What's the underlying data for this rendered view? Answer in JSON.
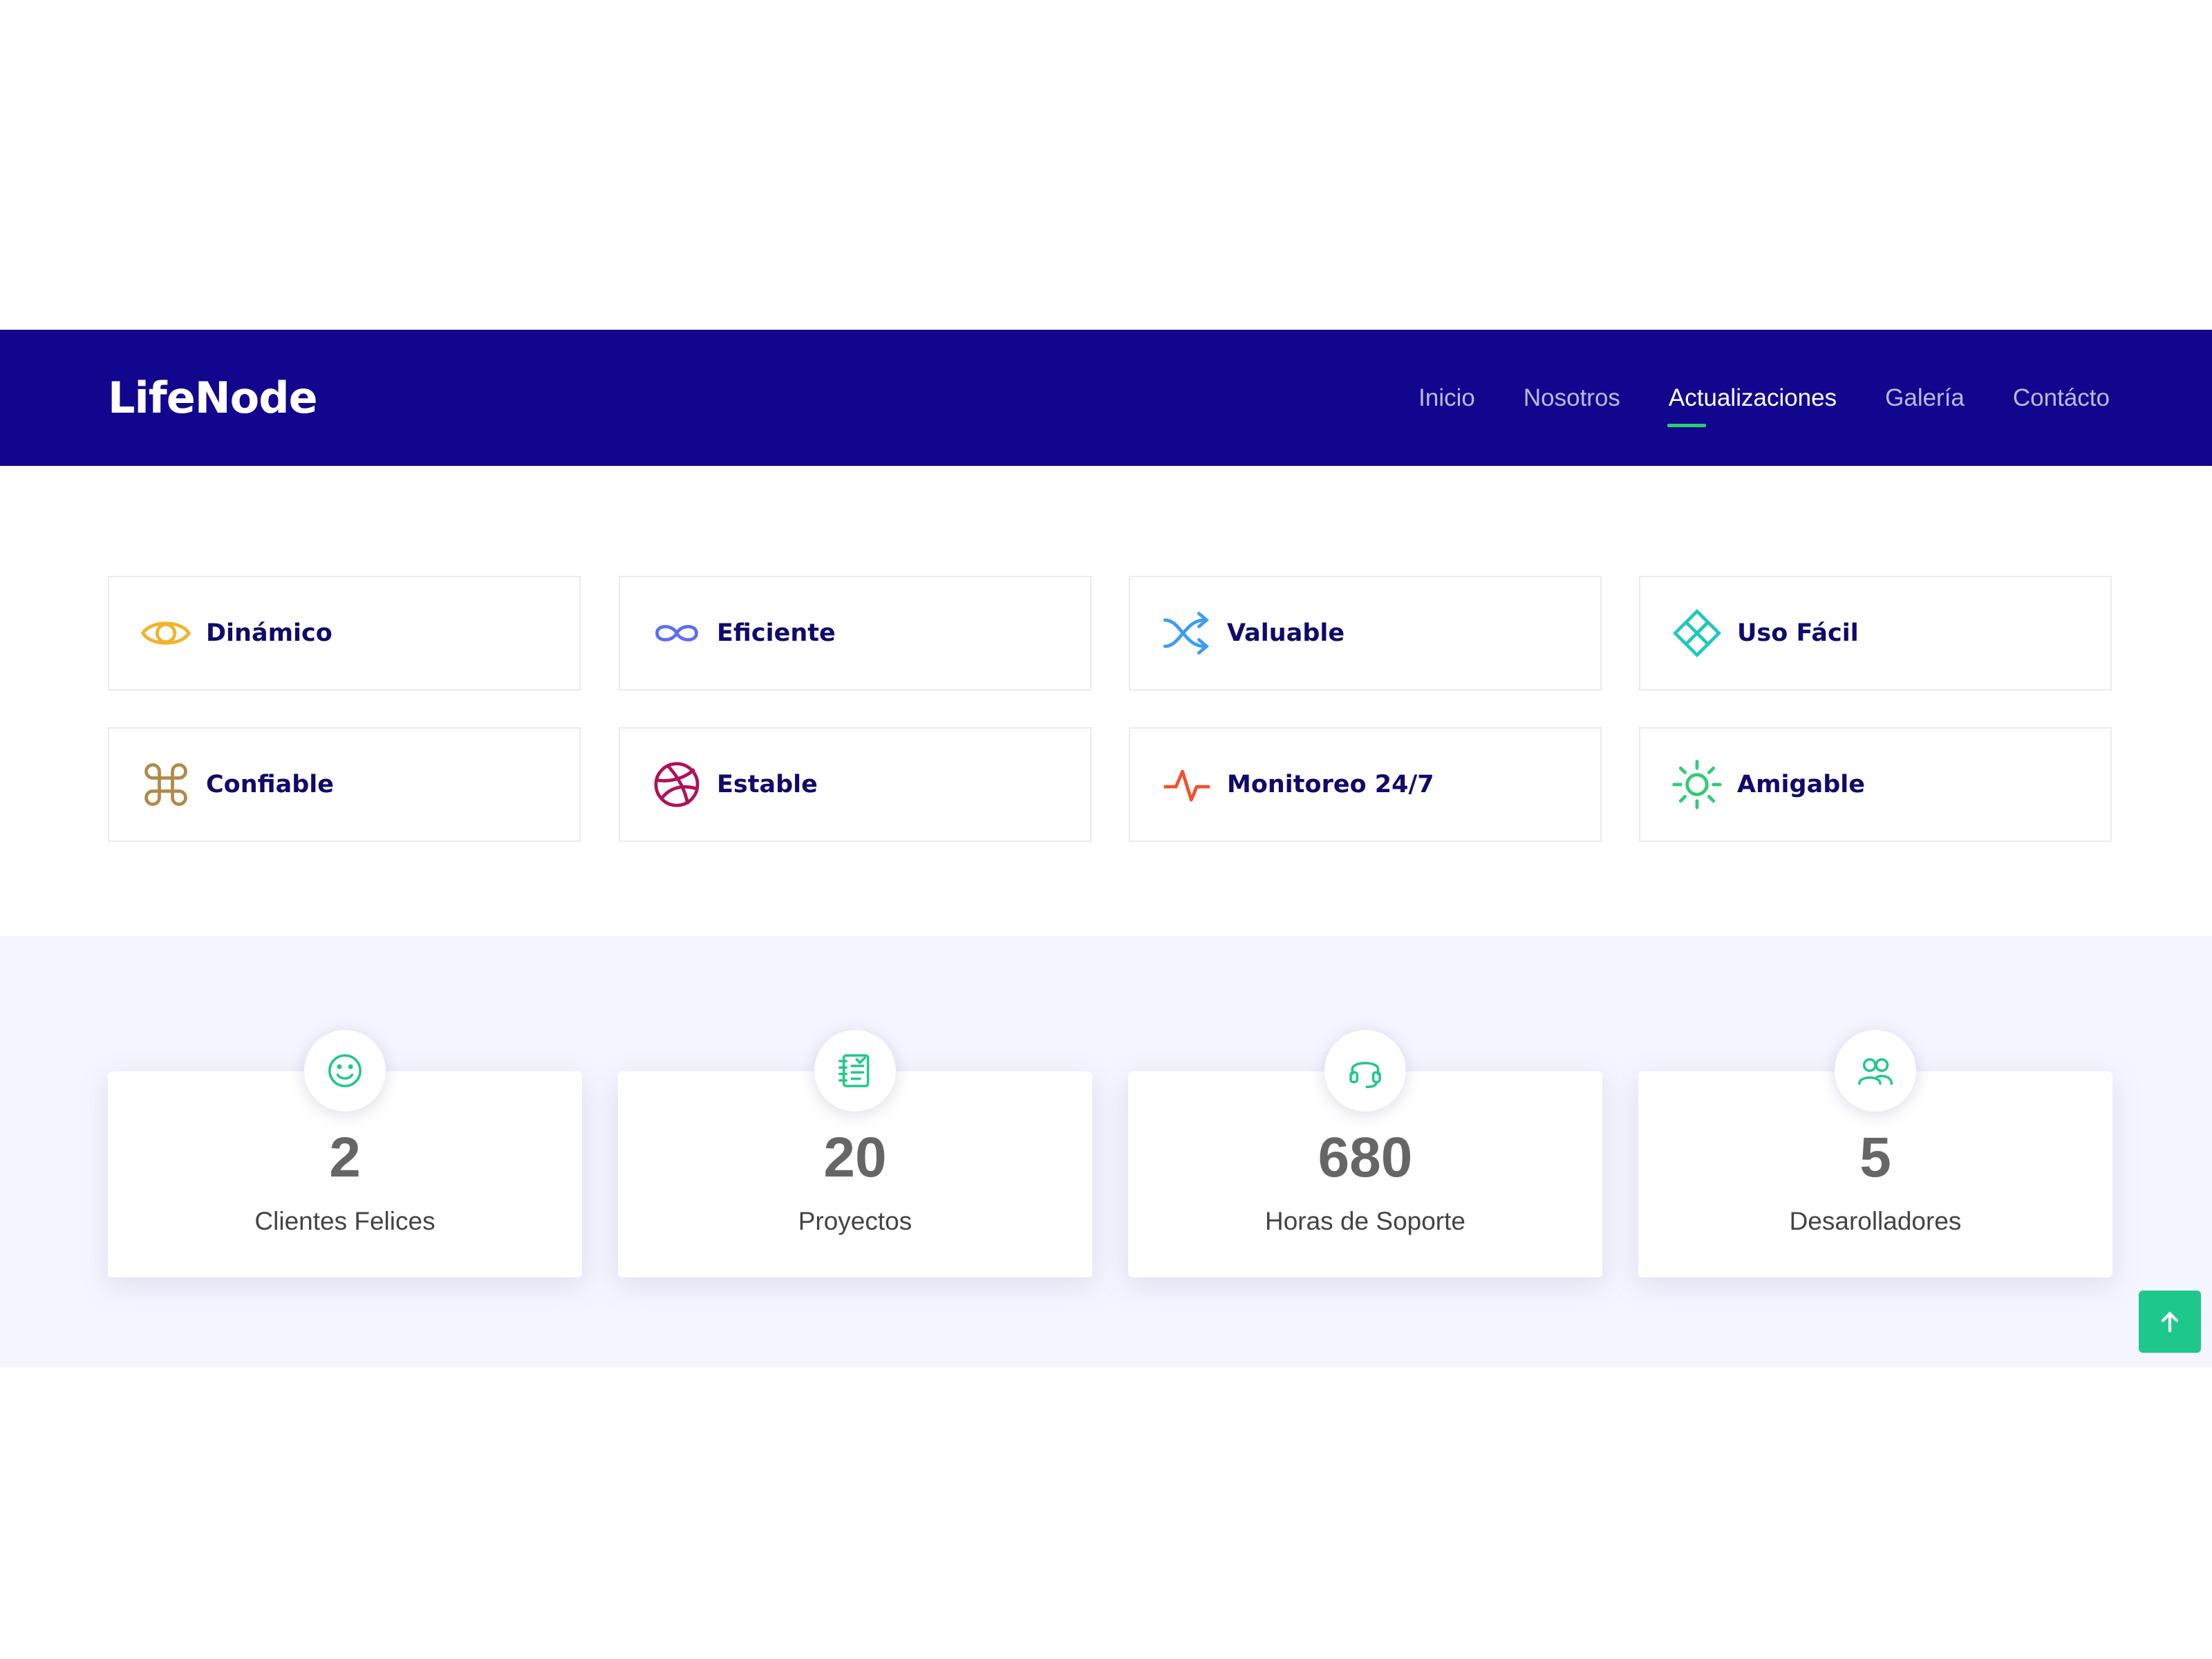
{
  "header": {
    "logo": "LifeNode",
    "nav": [
      {
        "label": "Inicio",
        "active": false
      },
      {
        "label": "Nosotros",
        "active": false
      },
      {
        "label": "Actualizaciones",
        "active": true
      },
      {
        "label": "Galería",
        "active": false
      },
      {
        "label": "Contácto",
        "active": false
      }
    ]
  },
  "features": [
    {
      "label": "Dinámico",
      "icon": "eye-icon",
      "color": "#f0b429"
    },
    {
      "label": "Eficiente",
      "icon": "infinity-icon",
      "color": "#5b6ef5"
    },
    {
      "label": "Valuable",
      "icon": "shuffle-icon",
      "color": "#3b9cf5"
    },
    {
      "label": "Uso Fácil",
      "icon": "diamond-grid-icon",
      "color": "#1fc8c0"
    },
    {
      "label": "Confiable",
      "icon": "command-icon",
      "color": "#b08a4a"
    },
    {
      "label": "Estable",
      "icon": "dribbble-icon",
      "color": "#b0105a"
    },
    {
      "label": "Monitoreo 24/7",
      "icon": "pulse-icon",
      "color": "#f5502b"
    },
    {
      "label": "Amigable",
      "icon": "sun-icon",
      "color": "#2ecc71"
    }
  ],
  "counts": [
    {
      "value": "2",
      "label": "Clientes Felices",
      "icon": "smiley-icon"
    },
    {
      "value": "20",
      "label": "Proyectos",
      "icon": "document-list-icon"
    },
    {
      "value": "680",
      "label": "Horas de Soporte",
      "icon": "headset-icon"
    },
    {
      "value": "5",
      "label": "Desarolladores",
      "icon": "users-icon"
    }
  ],
  "colors": {
    "navbar": "#12068f",
    "accent": "#1ec88a",
    "counts_bg": "#f5f5ff"
  },
  "back_to_top": {
    "icon": "arrow-up-icon"
  }
}
